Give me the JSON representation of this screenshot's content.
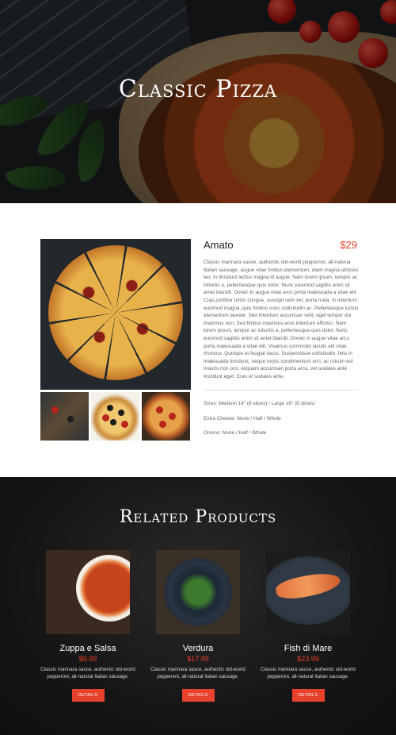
{
  "hero": {
    "title": "Classic Pizza"
  },
  "product": {
    "name": "Amato",
    "price": "$29",
    "description": "Classic marinara sauce, authentic old-world pepperoni, all-natural Italian sausage, augue vitae finibus elementum, diam magna ultricies leo, in tincidunt lectus magna id augue. Nam lorem ipsum, tempor ac lobortis a, pellentesque quis dolor. Nunc euismod sagittis enim sit amet blandit. Donec in augue vitae arcu porta malesuada a vitae elit. Cras porttitor tortor congue, suscipit sem vel, porta nulla. In interdum euismod magna, quis finibus nunc sollicitudin ac. Pellentesque luctus elementum laoreet. Sed interdum accumsan velit, eget tempor dui maximus non. Sed finibus maximus eros interdum efficitur. Nam lorem ipsum, tempor ac lobortis a, pellentesque quis dolor. Nunc euismod sagittis enim sit amet blandit. Donec in augue vitae arcu porta malesuada a vitae elit. Vivamus commodo iaculis elit vitae rhoncus. Quisque et feugiat lacus. Suspendisse sollicitudin, felis in malesuada tincidunt, neque turpis condimentum orci, ac rutrum est mauris non orci. Aliquam accumsan porta arcu, vel sodales ante tincidunt eget. Cras et sodales ante.",
    "options": {
      "sizes": "Sizes: Medium 14\" (6 slices) / Large 16\" (8 slices)",
      "cheese": "Extra Cheese: None / Half / Whole",
      "onions": "Onions: None / Half / Whole"
    }
  },
  "related": {
    "title": "Related Products",
    "button_label": "DETAILS",
    "items": [
      {
        "name": "Zuppa e Salsa",
        "price": "$9.99",
        "desc": "Classic marinara sauce, authentic old-world pepperoni, all-natural Italian sausage."
      },
      {
        "name": "Verdura",
        "price": "$17.99",
        "desc": "Classic marinara sauce, authentic old-world pepperoni, all-natural Italian sausage."
      },
      {
        "name": "Fish di Mare",
        "price": "$23.99",
        "desc": "Classic marinara sauce, authentic old-world pepperoni, all-natural Italian sausage."
      }
    ]
  },
  "colors": {
    "accent": "#e8412c",
    "dark_bg": "#161616",
    "text_muted": "#666666"
  }
}
